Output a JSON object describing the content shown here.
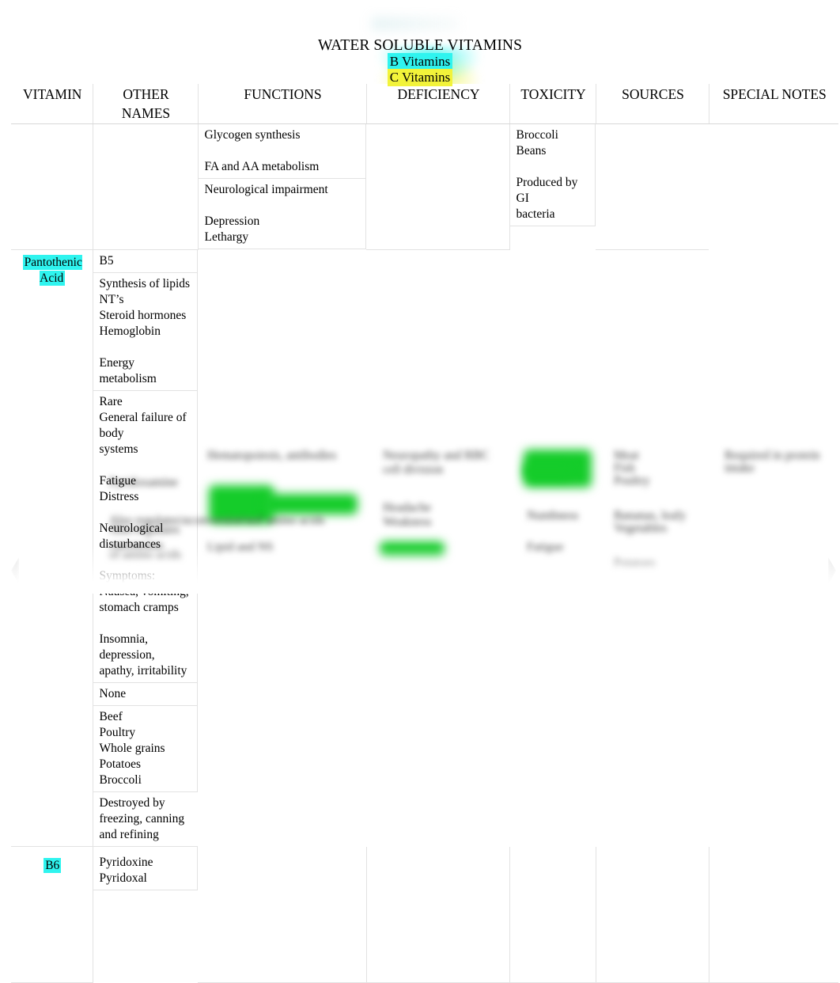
{
  "document": {
    "title": "WATER SOLUBLE VITAMINS",
    "subtitle_b": "B Vitamins",
    "subtitle_c": "C Vitamins",
    "highlight_cyan": "#2ff4ef",
    "highlight_yellow": "#f2f33a",
    "highlight_green": "#15cc2a"
  },
  "table": {
    "headers": [
      "VITAMIN",
      "OTHER NAMES",
      "FUNCTIONS",
      "DEFICIENCY",
      "TOXICITY",
      "SOURCES",
      "SPECIAL NOTES"
    ],
    "rows": [
      {
        "vitamin": "",
        "other_names": "",
        "functions": "Glycogen synthesis\n\nFA and AA metabolism",
        "deficiency": "Neurological impairment\n\nDepression\nLethargy",
        "toxicity": "",
        "sources": "Broccoli\nBeans\n\nProduced by GI\nbacteria",
        "special_notes": ""
      },
      {
        "vitamin": "Pantothenic Acid",
        "other_names": "B5",
        "functions": "Synthesis of lipids\nNT’s\nSteroid hormones\nHemoglobin\n\nEnergy metabolism",
        "deficiency": "Rare\nGeneral failure of body\nsystems\n\nFatigue\nDistress\n\nNeurological\ndisturbances\n\nSymptoms:\nNausea, vomiting,\nstomach cramps\n\nInsomnia, depression,\napathy, irritability",
        "toxicity": "None",
        "sources": "Beef\nPoultry\nWhole grains\nPotatoes\nBroccoli",
        "special_notes": "Destroyed by\nfreezing, canning\nand refining"
      },
      {
        "vitamin": "B6",
        "other_names": "Pyridoxine\nPyridoxal",
        "functions": "",
        "deficiency": "",
        "toxicity": "",
        "sources": "",
        "special_notes": ""
      }
    ]
  }
}
